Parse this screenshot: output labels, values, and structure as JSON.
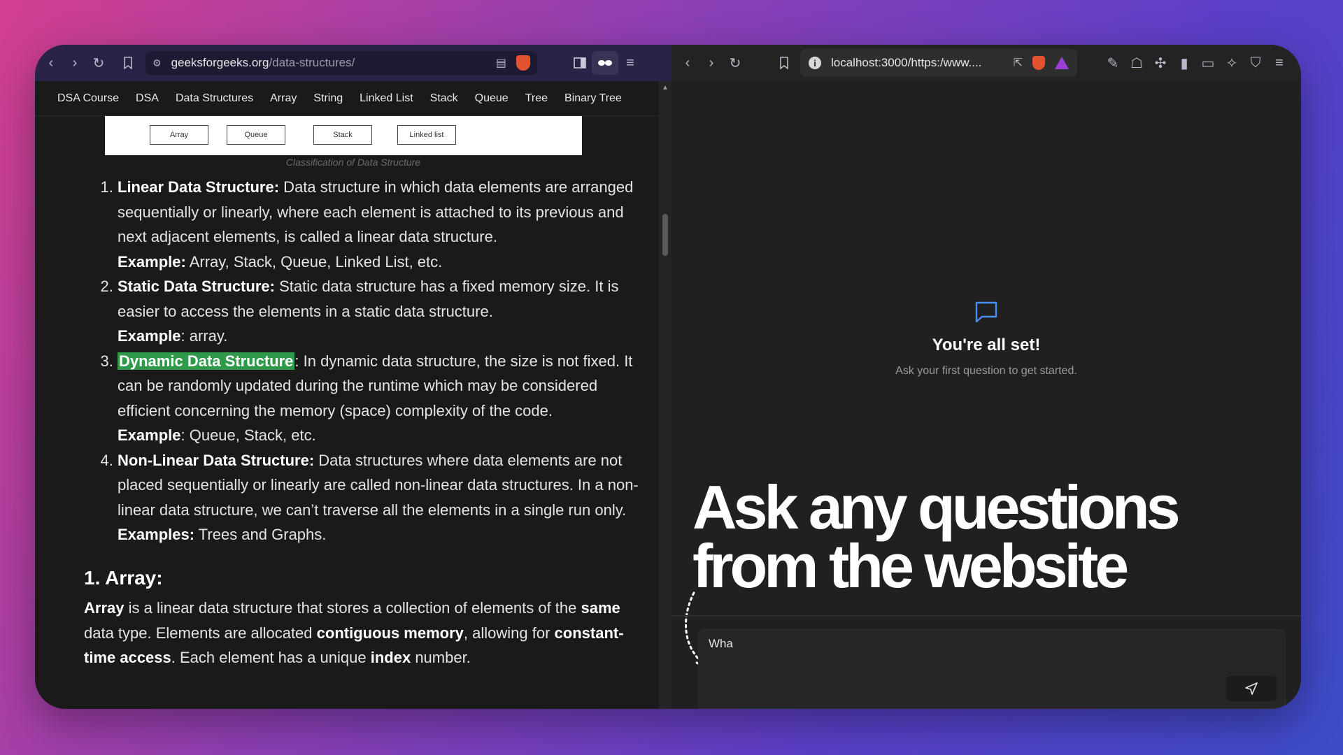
{
  "left_browser": {
    "url_domain": "geeksforgeeks.org",
    "url_path": "/data-structures/",
    "nav_links": [
      "DSA Course",
      "DSA",
      "Data Structures",
      "Array",
      "String",
      "Linked List",
      "Stack",
      "Queue",
      "Tree",
      "Binary Tree"
    ],
    "diagram_boxes": [
      "Array",
      "Queue",
      "Stack",
      "Linked list"
    ],
    "diagram_caption": "Classification of Data Structure",
    "items": [
      {
        "title": "Linear Data Structure:",
        "text": " Data structure in which data elements are arranged sequentially or linearly, where each element is attached to its previous and next adjacent elements, is called a linear data structure.",
        "example_label": "Example:",
        "example_text": " Array, Stack, Queue, Linked List, etc."
      },
      {
        "title": "Static Data Structure:",
        "text": " Static data structure has a fixed memory size. It is easier to access the elements in a static data structure.",
        "example_label": "Example",
        "example_text": ": array."
      },
      {
        "title": "Dynamic Data Structure",
        "text": ": In dynamic data structure, the size is not fixed. It can be randomly updated during the runtime which may be considered efficient concerning the memory (space) complexity of the code.",
        "example_label": "Example",
        "example_text": ": Queue, Stack, etc."
      },
      {
        "title": "Non-Linear Data Structure:",
        "text": " Data structures where data elements are not placed sequentially or linearly are called non-linear data structures. In a non-linear data structure, we can’t traverse all the elements in a single run only.",
        "example_label": "Examples:",
        "example_text": " Trees and Graphs."
      }
    ],
    "array_heading": "1. Array:",
    "array_para": {
      "p1": "Array",
      "p2": " is a linear data structure that stores a collection of elements of the ",
      "p3": "same",
      "p4": " data type. Elements are allocated ",
      "p5": "contiguous memory",
      "p6": ", allowing for ",
      "p7": "constant-time access",
      "p8": ". Each element has a unique ",
      "p9": "index",
      "p10": " number."
    }
  },
  "right_browser": {
    "url": "localhost:3000/https:/www....",
    "welcome_title": "You're all set!",
    "welcome_subtitle": "Ask your first question to get started.",
    "overlay_line1": "Ask any questions",
    "overlay_line2": "from the website",
    "input_value": "Wha"
  },
  "colors": {
    "highlight": "#2e9a4a",
    "chat_icon": "#4a8ff0"
  }
}
